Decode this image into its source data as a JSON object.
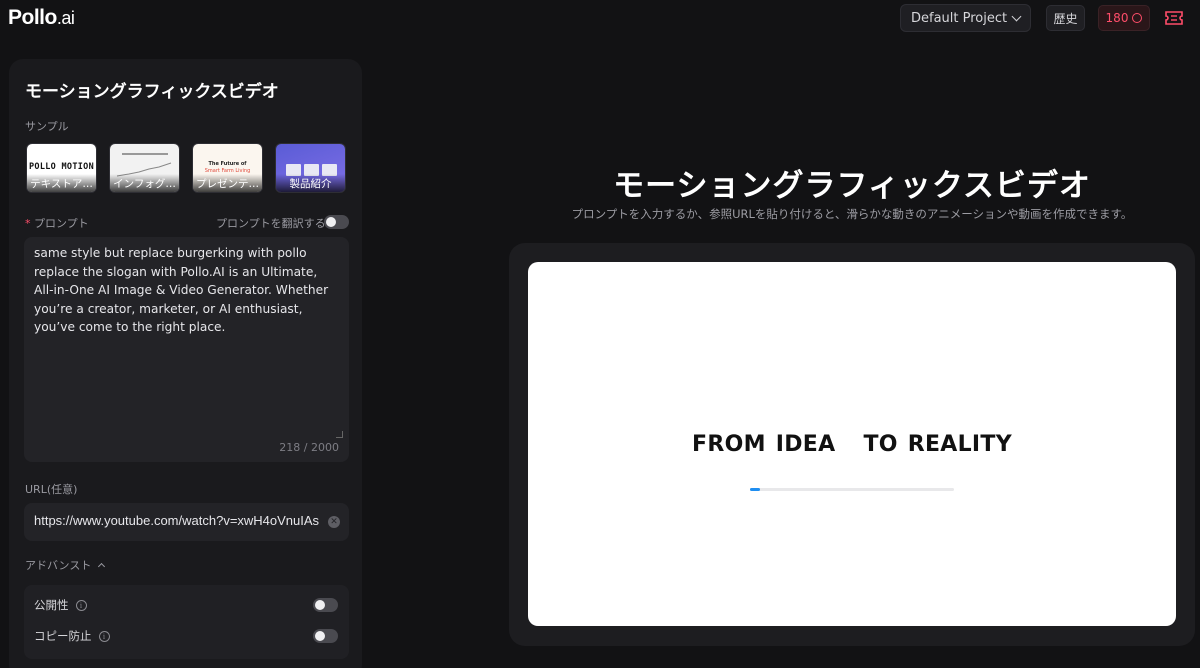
{
  "header": {
    "logo_main": "Pollo",
    "logo_suffix": ".ai",
    "project_select": "Default Project",
    "history_label": "歴史",
    "credits": "180"
  },
  "panel": {
    "title": "モーショングラフィックスビデオ",
    "samples_label": "サンプル",
    "samples": [
      {
        "caption": "テキストア…",
        "thumb_text": "POLLO MOTION"
      },
      {
        "caption": "インフォグ…"
      },
      {
        "caption": "プレゼンテ…",
        "thumb_text_a": "The Future of",
        "thumb_text_b": "Smart Farm Living"
      },
      {
        "caption": "製品紹介"
      }
    ],
    "prompt_label": "プロンプト",
    "translate_label": "プロンプトを翻訳する",
    "prompt_text": "same style but replace burgerking with pollo replace the slogan with Pollo.AI is an Ultimate, All-in-One AI Image & Video Generator. Whether you’re a creator, marketer, or AI enthusiast, you’ve come to the right place.",
    "char_count": "218 / 2000",
    "url_label": "URL(任意)",
    "url_value": "https://www.youtube.com/watch?v=xwH4oVnuIAs",
    "advanced_label": "アドバンスト",
    "advanced": {
      "public_label": "公開性",
      "public_on": false,
      "copy_protect_label": "コピー防止",
      "copy_protect_on": false
    }
  },
  "main": {
    "title": "モーショングラフィックスビデオ",
    "subtitle": "プロンプトを入力するか、参照URLを貼り付けると、滑らかな動きのアニメーションや動画を作成できます。",
    "preview_text_left": "FROM IDEA",
    "preview_text_right": "TO REALITY",
    "preview_progress": 0.05
  },
  "colors": {
    "background": "#121214",
    "panel": "#1a1a1d",
    "accent_red": "#ff4d6a",
    "progress_blue": "#1f8ef1"
  },
  "icons": [
    "chevron-down-icon",
    "coin-icon",
    "ticket-icon",
    "chevron-up-icon",
    "info-icon",
    "clear-icon"
  ]
}
